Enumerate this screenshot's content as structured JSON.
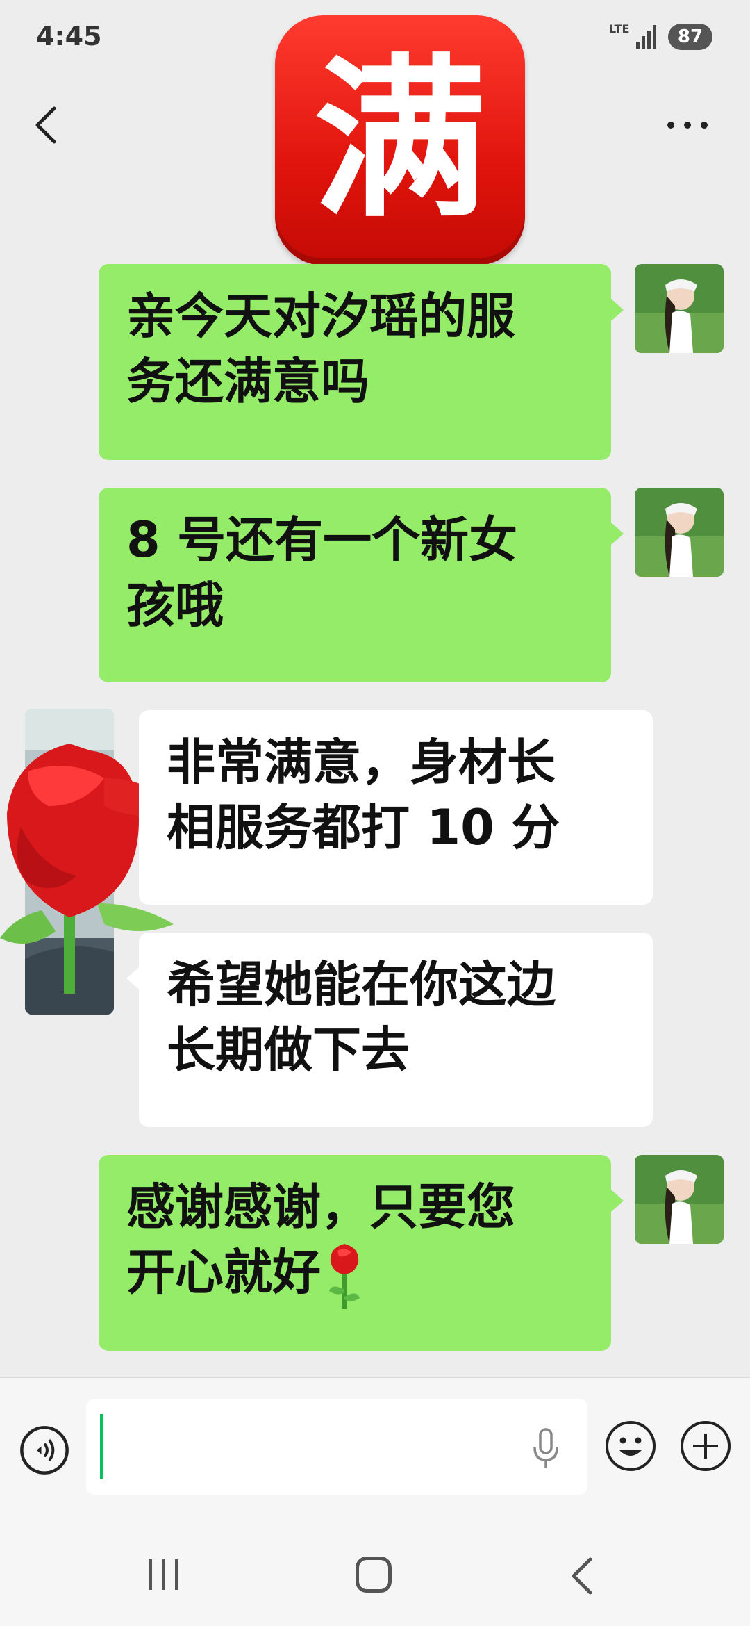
{
  "status_bar": {
    "time": "4:45",
    "network": "LTE",
    "battery": "87"
  },
  "sticker_top": {
    "char": "满"
  },
  "messages": [
    {
      "side": "out",
      "lines": [
        "亲今天对汐瑶的服",
        "务还满意吗"
      ]
    },
    {
      "side": "out",
      "lines": [
        "8 号还有一个新女",
        "孩哦"
      ]
    },
    {
      "side": "in",
      "lines": [
        "非常满意，身材长",
        "相服务都打 10 分"
      ]
    },
    {
      "side": "in",
      "lines": [
        "希望她能在你这边",
        "长期做下去"
      ]
    },
    {
      "side": "out",
      "lines": [
        "感谢感谢，只要您",
        "开心就好"
      ]
    }
  ],
  "input": {
    "value": ""
  },
  "colors": {
    "outgoing": "#95ec69",
    "incoming": "#ffffff",
    "background": "#ededed",
    "accent": "#07c160"
  },
  "icons": [
    "back-chevron-icon",
    "more-dots-icon",
    "voice-icon",
    "mic-icon",
    "emoji-icon",
    "plus-icon",
    "recent-apps-icon",
    "home-icon",
    "back-icon",
    "rose-icon"
  ]
}
